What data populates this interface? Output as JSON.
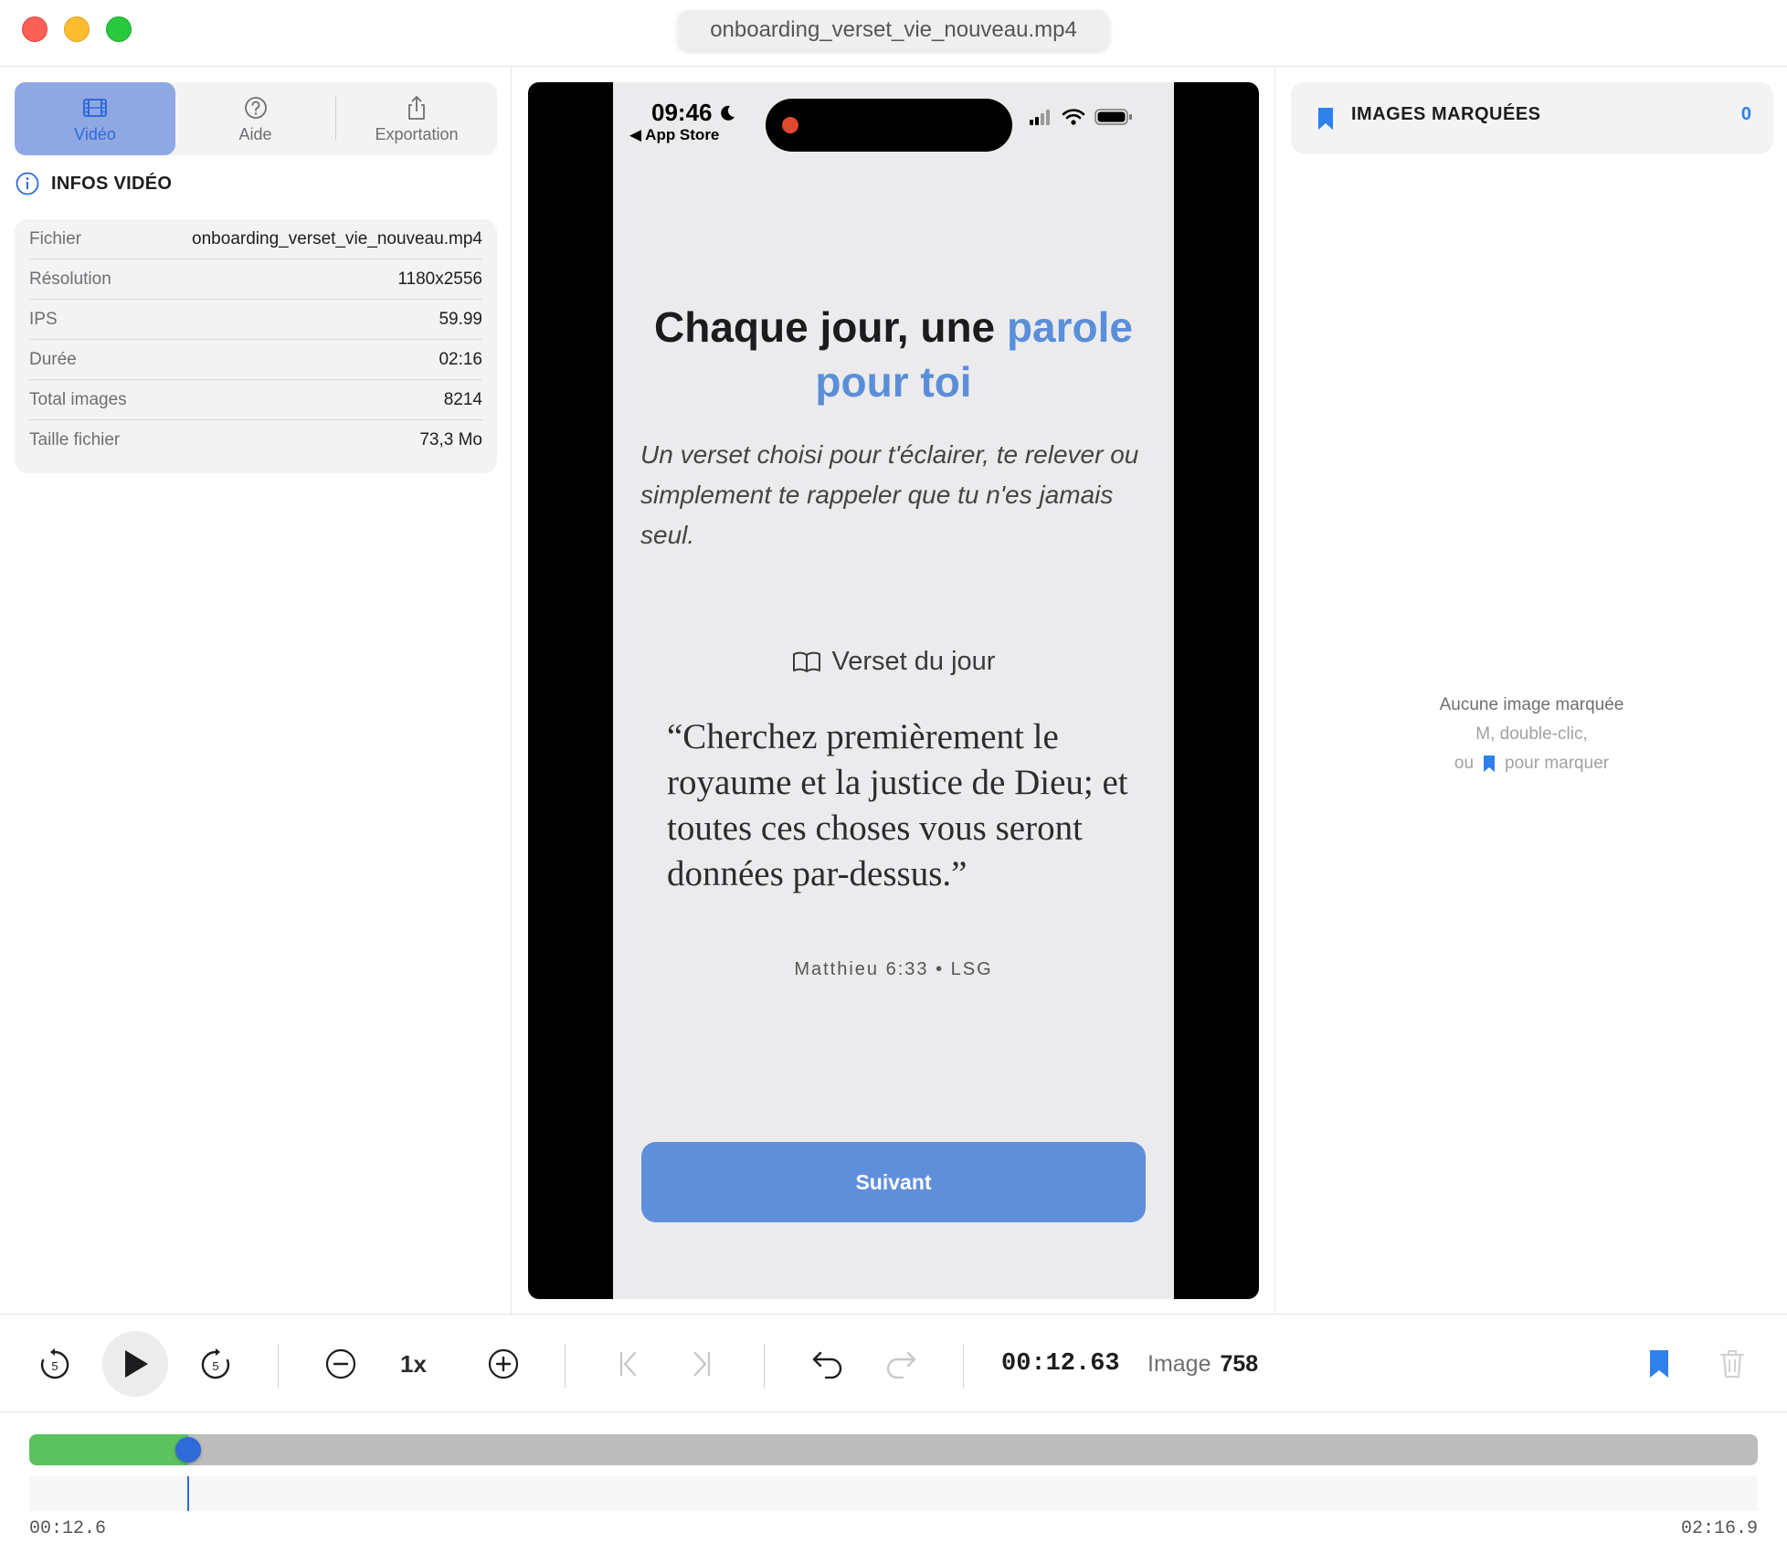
{
  "window": {
    "title": "onboarding_verset_vie_nouveau.mp4"
  },
  "tabs": [
    {
      "label": "Vidéo",
      "icon": "film-icon",
      "active": true
    },
    {
      "label": "Aide",
      "icon": "question-circle-icon",
      "active": false
    },
    {
      "label": "Exportation",
      "icon": "share-icon",
      "active": false
    }
  ],
  "info": {
    "heading": "INFOS VIDÉO",
    "rows": [
      {
        "key": "Fichier",
        "value": "onboarding_verset_vie_nouveau.mp4"
      },
      {
        "key": "Résolution",
        "value": "1180x2556"
      },
      {
        "key": "IPS",
        "value": "59.99"
      },
      {
        "key": "Durée",
        "value": "02:16"
      },
      {
        "key": "Total images",
        "value": "8214"
      },
      {
        "key": "Taille fichier",
        "value": "73,3 Mo"
      }
    ]
  },
  "phone": {
    "time": "09:46",
    "back_app": "◀ App Store",
    "headline_plain": "Chaque jour, une ",
    "headline_accent": "parole pour toi",
    "lede": "Un verset choisi pour t'éclairer, te relever ou simplement te rappeler que tu n'es jamais seul.",
    "verse_label": "Verset du jour",
    "verse_text": "“Cherchez premièrement le royaume et la justice de Dieu; et toutes ces choses vous seront données par-dessus.”",
    "verse_ref": "Matthieu 6:33 • LSG",
    "cta": "Suivant",
    "accent_color": "#5b8ed9"
  },
  "marks": {
    "title": "IMAGES MARQUÉES",
    "count": "0",
    "empty_title": "Aucune image marquée",
    "empty_hint_1": "M, double-clic,",
    "empty_hint_2_pre": "ou",
    "empty_hint_2_post": "pour marquer"
  },
  "controls": {
    "skip_back_label": "5",
    "skip_fwd_label": "5",
    "speed": "1x",
    "timecode": "00:12.63",
    "frame_label": "Image",
    "frame_number": "758"
  },
  "timeline": {
    "start": "00:12.6",
    "end": "02:16.9",
    "progress": 0.092,
    "played_color": "#5cc25f"
  }
}
